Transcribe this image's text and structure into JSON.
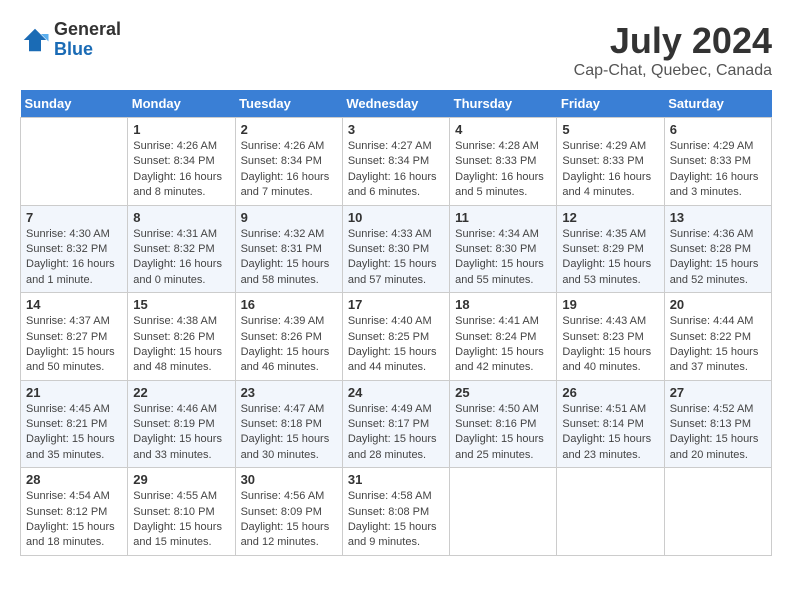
{
  "logo": {
    "general": "General",
    "blue": "Blue"
  },
  "title": "July 2024",
  "subtitle": "Cap-Chat, Quebec, Canada",
  "days_of_week": [
    "Sunday",
    "Monday",
    "Tuesday",
    "Wednesday",
    "Thursday",
    "Friday",
    "Saturday"
  ],
  "weeks": [
    [
      {
        "day": "",
        "info": ""
      },
      {
        "day": "1",
        "info": "Sunrise: 4:26 AM\nSunset: 8:34 PM\nDaylight: 16 hours\nand 8 minutes."
      },
      {
        "day": "2",
        "info": "Sunrise: 4:26 AM\nSunset: 8:34 PM\nDaylight: 16 hours\nand 7 minutes."
      },
      {
        "day": "3",
        "info": "Sunrise: 4:27 AM\nSunset: 8:34 PM\nDaylight: 16 hours\nand 6 minutes."
      },
      {
        "day": "4",
        "info": "Sunrise: 4:28 AM\nSunset: 8:33 PM\nDaylight: 16 hours\nand 5 minutes."
      },
      {
        "day": "5",
        "info": "Sunrise: 4:29 AM\nSunset: 8:33 PM\nDaylight: 16 hours\nand 4 minutes."
      },
      {
        "day": "6",
        "info": "Sunrise: 4:29 AM\nSunset: 8:33 PM\nDaylight: 16 hours\nand 3 minutes."
      }
    ],
    [
      {
        "day": "7",
        "info": "Sunrise: 4:30 AM\nSunset: 8:32 PM\nDaylight: 16 hours\nand 1 minute."
      },
      {
        "day": "8",
        "info": "Sunrise: 4:31 AM\nSunset: 8:32 PM\nDaylight: 16 hours\nand 0 minutes."
      },
      {
        "day": "9",
        "info": "Sunrise: 4:32 AM\nSunset: 8:31 PM\nDaylight: 15 hours\nand 58 minutes."
      },
      {
        "day": "10",
        "info": "Sunrise: 4:33 AM\nSunset: 8:30 PM\nDaylight: 15 hours\nand 57 minutes."
      },
      {
        "day": "11",
        "info": "Sunrise: 4:34 AM\nSunset: 8:30 PM\nDaylight: 15 hours\nand 55 minutes."
      },
      {
        "day": "12",
        "info": "Sunrise: 4:35 AM\nSunset: 8:29 PM\nDaylight: 15 hours\nand 53 minutes."
      },
      {
        "day": "13",
        "info": "Sunrise: 4:36 AM\nSunset: 8:28 PM\nDaylight: 15 hours\nand 52 minutes."
      }
    ],
    [
      {
        "day": "14",
        "info": "Sunrise: 4:37 AM\nSunset: 8:27 PM\nDaylight: 15 hours\nand 50 minutes."
      },
      {
        "day": "15",
        "info": "Sunrise: 4:38 AM\nSunset: 8:26 PM\nDaylight: 15 hours\nand 48 minutes."
      },
      {
        "day": "16",
        "info": "Sunrise: 4:39 AM\nSunset: 8:26 PM\nDaylight: 15 hours\nand 46 minutes."
      },
      {
        "day": "17",
        "info": "Sunrise: 4:40 AM\nSunset: 8:25 PM\nDaylight: 15 hours\nand 44 minutes."
      },
      {
        "day": "18",
        "info": "Sunrise: 4:41 AM\nSunset: 8:24 PM\nDaylight: 15 hours\nand 42 minutes."
      },
      {
        "day": "19",
        "info": "Sunrise: 4:43 AM\nSunset: 8:23 PM\nDaylight: 15 hours\nand 40 minutes."
      },
      {
        "day": "20",
        "info": "Sunrise: 4:44 AM\nSunset: 8:22 PM\nDaylight: 15 hours\nand 37 minutes."
      }
    ],
    [
      {
        "day": "21",
        "info": "Sunrise: 4:45 AM\nSunset: 8:21 PM\nDaylight: 15 hours\nand 35 minutes."
      },
      {
        "day": "22",
        "info": "Sunrise: 4:46 AM\nSunset: 8:19 PM\nDaylight: 15 hours\nand 33 minutes."
      },
      {
        "day": "23",
        "info": "Sunrise: 4:47 AM\nSunset: 8:18 PM\nDaylight: 15 hours\nand 30 minutes."
      },
      {
        "day": "24",
        "info": "Sunrise: 4:49 AM\nSunset: 8:17 PM\nDaylight: 15 hours\nand 28 minutes."
      },
      {
        "day": "25",
        "info": "Sunrise: 4:50 AM\nSunset: 8:16 PM\nDaylight: 15 hours\nand 25 minutes."
      },
      {
        "day": "26",
        "info": "Sunrise: 4:51 AM\nSunset: 8:14 PM\nDaylight: 15 hours\nand 23 minutes."
      },
      {
        "day": "27",
        "info": "Sunrise: 4:52 AM\nSunset: 8:13 PM\nDaylight: 15 hours\nand 20 minutes."
      }
    ],
    [
      {
        "day": "28",
        "info": "Sunrise: 4:54 AM\nSunset: 8:12 PM\nDaylight: 15 hours\nand 18 minutes."
      },
      {
        "day": "29",
        "info": "Sunrise: 4:55 AM\nSunset: 8:10 PM\nDaylight: 15 hours\nand 15 minutes."
      },
      {
        "day": "30",
        "info": "Sunrise: 4:56 AM\nSunset: 8:09 PM\nDaylight: 15 hours\nand 12 minutes."
      },
      {
        "day": "31",
        "info": "Sunrise: 4:58 AM\nSunset: 8:08 PM\nDaylight: 15 hours\nand 9 minutes."
      },
      {
        "day": "",
        "info": ""
      },
      {
        "day": "",
        "info": ""
      },
      {
        "day": "",
        "info": ""
      }
    ]
  ]
}
